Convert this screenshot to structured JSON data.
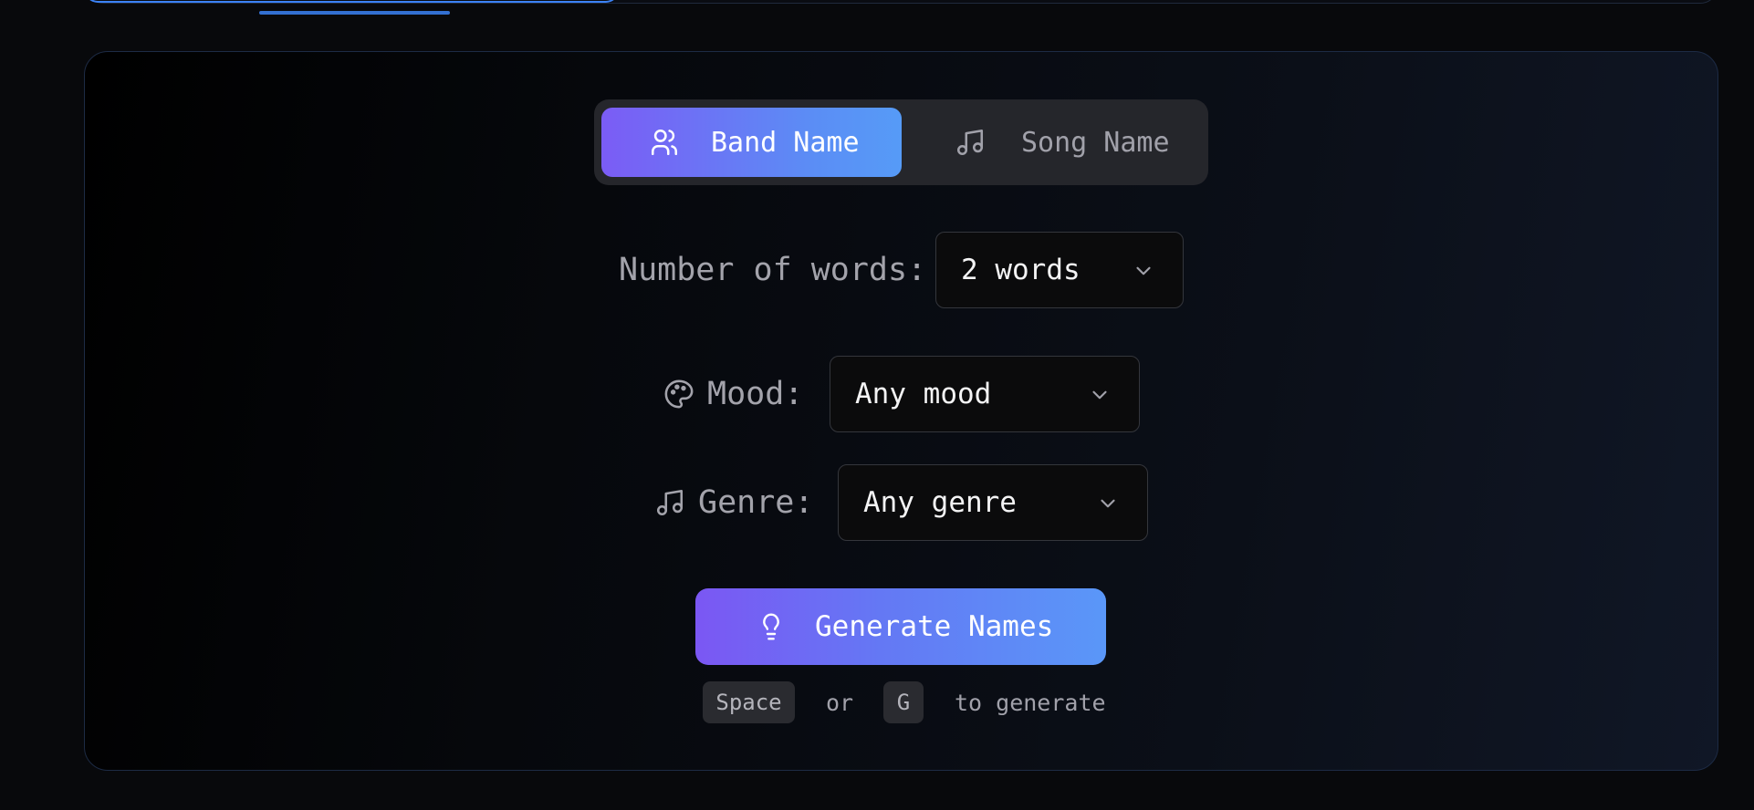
{
  "mode_toggle": {
    "band_name_label": "Band Name",
    "band_name_icon": "users-icon",
    "song_name_label": "Song Name",
    "song_name_icon": "music-note-icon",
    "selected": "Band Name"
  },
  "word_count": {
    "label": "Number of words:",
    "value": "2 words"
  },
  "mood": {
    "label": "Mood:",
    "icon": "palette-icon",
    "value": "Any mood"
  },
  "genre": {
    "label": "Genre:",
    "icon": "music-note-icon",
    "value": "Any genre"
  },
  "generate": {
    "label": "Generate Names",
    "icon": "lightbulb-icon"
  },
  "shortcut_hint": {
    "key1": "Space",
    "or": "or",
    "key2": "G",
    "suffix": "to generate"
  },
  "colors": {
    "accent_start": "#7b57f3",
    "accent_end": "#5a97f8",
    "panel_border": "#1d2b45",
    "tab_indicator": "#3b82f6"
  }
}
